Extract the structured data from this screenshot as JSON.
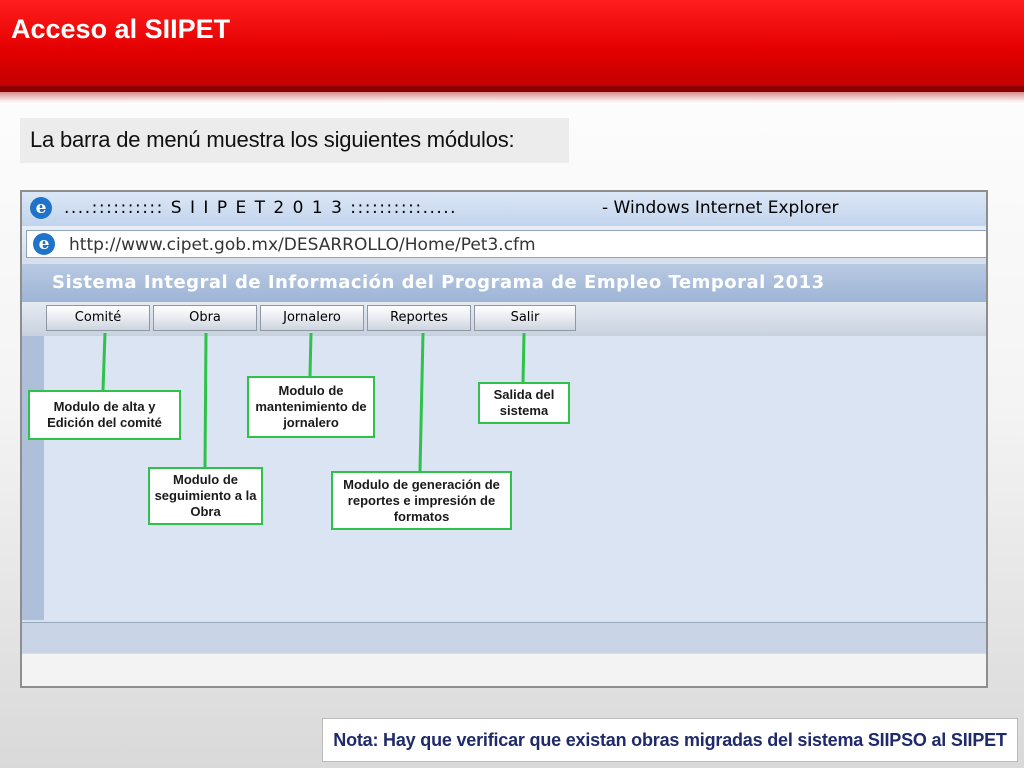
{
  "slide": {
    "title": "Acceso al SIIPET",
    "subtitle": "La barra de menú muestra los siguientes módulos:",
    "note": "Nota: Hay que verificar que existan obras migradas del sistema SIIPSO al SIIPET"
  },
  "browser": {
    "window_title": "....:::::::::: S I I P E T 2 0 1 3 ::::::::::.....",
    "window_app": "- Windows Internet Explorer",
    "url": "http://www.cipet.gob.mx/DESARROLLO/Home/Pet3.cfm",
    "icon_letter": "e",
    "app_title": "Sistema Integral de Información del Programa de Empleo Temporal 2013"
  },
  "menu": {
    "items": [
      "Comité",
      "Obra",
      "Jornalero",
      "Reportes",
      "Salir"
    ]
  },
  "callouts": {
    "comite": "Modulo de alta y Edición del comité",
    "obra": "Modulo de seguimiento a la Obra",
    "jornalero": "Modulo de mantenimiento de jornalero",
    "reportes": "Modulo de generación de reportes e impresión de formatos",
    "salir": "Salida del sistema"
  },
  "colors": {
    "header_red": "#e40000",
    "callout_border": "#2fc24a",
    "note_text": "#1f2a6b"
  },
  "icons": {
    "browser": "internet-explorer-icon"
  }
}
